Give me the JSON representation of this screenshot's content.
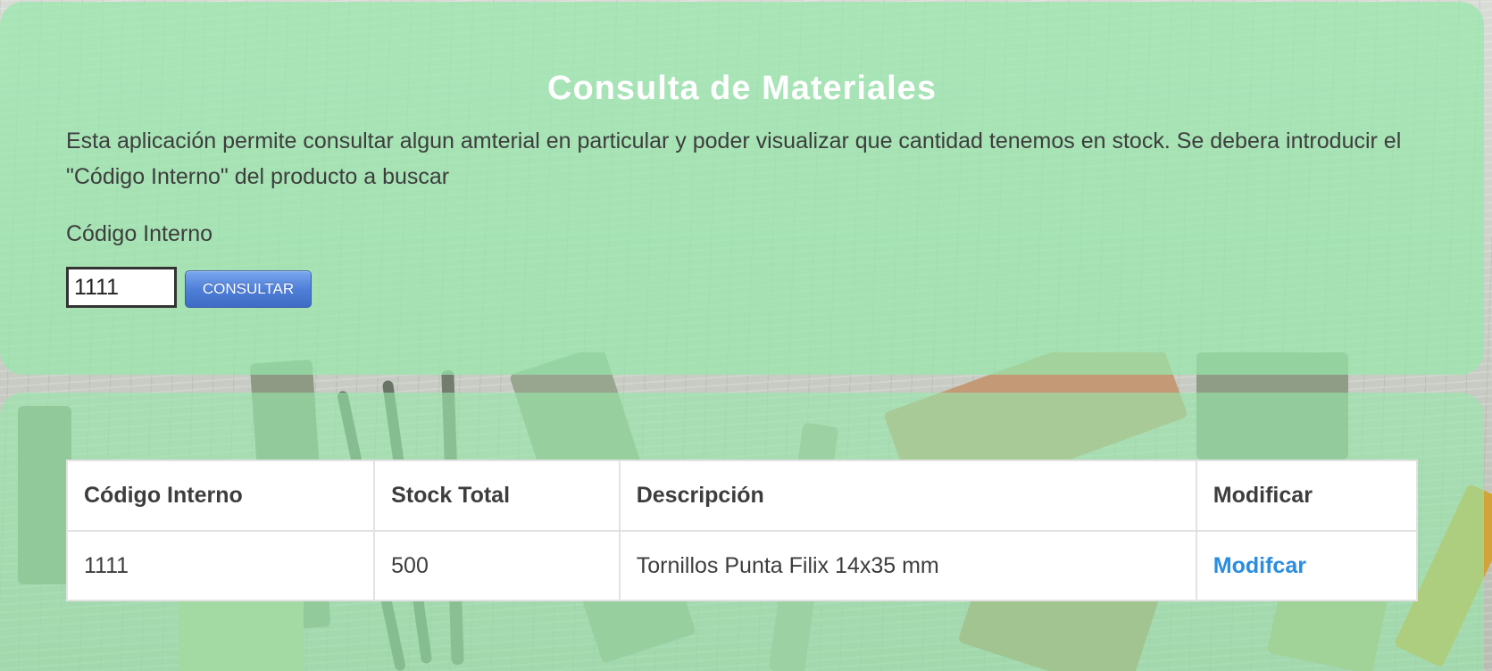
{
  "header": {
    "title": "Consulta de Materiales",
    "description": "Esta aplicación permite consultar algun amterial en particular y poder visualizar que cantidad tenemos en stock. Se debera introducir el \"Código Interno\" del producto a buscar"
  },
  "form": {
    "code_label": "Código Interno",
    "code_value": "1111",
    "submit_label": "CONSULTAR"
  },
  "results": {
    "columns": [
      "Código Interno",
      "Stock Total",
      "Descripción",
      "Modificar"
    ],
    "rows": [
      {
        "code": "1111",
        "stock": "500",
        "description": "Tornillos Punta Filix 14x35 mm",
        "action_label": "Modifcar"
      }
    ]
  },
  "colors": {
    "panel": "#96e8aa",
    "title": "#ffffff",
    "button": "#4f7fd8",
    "link": "#2a8de0"
  }
}
